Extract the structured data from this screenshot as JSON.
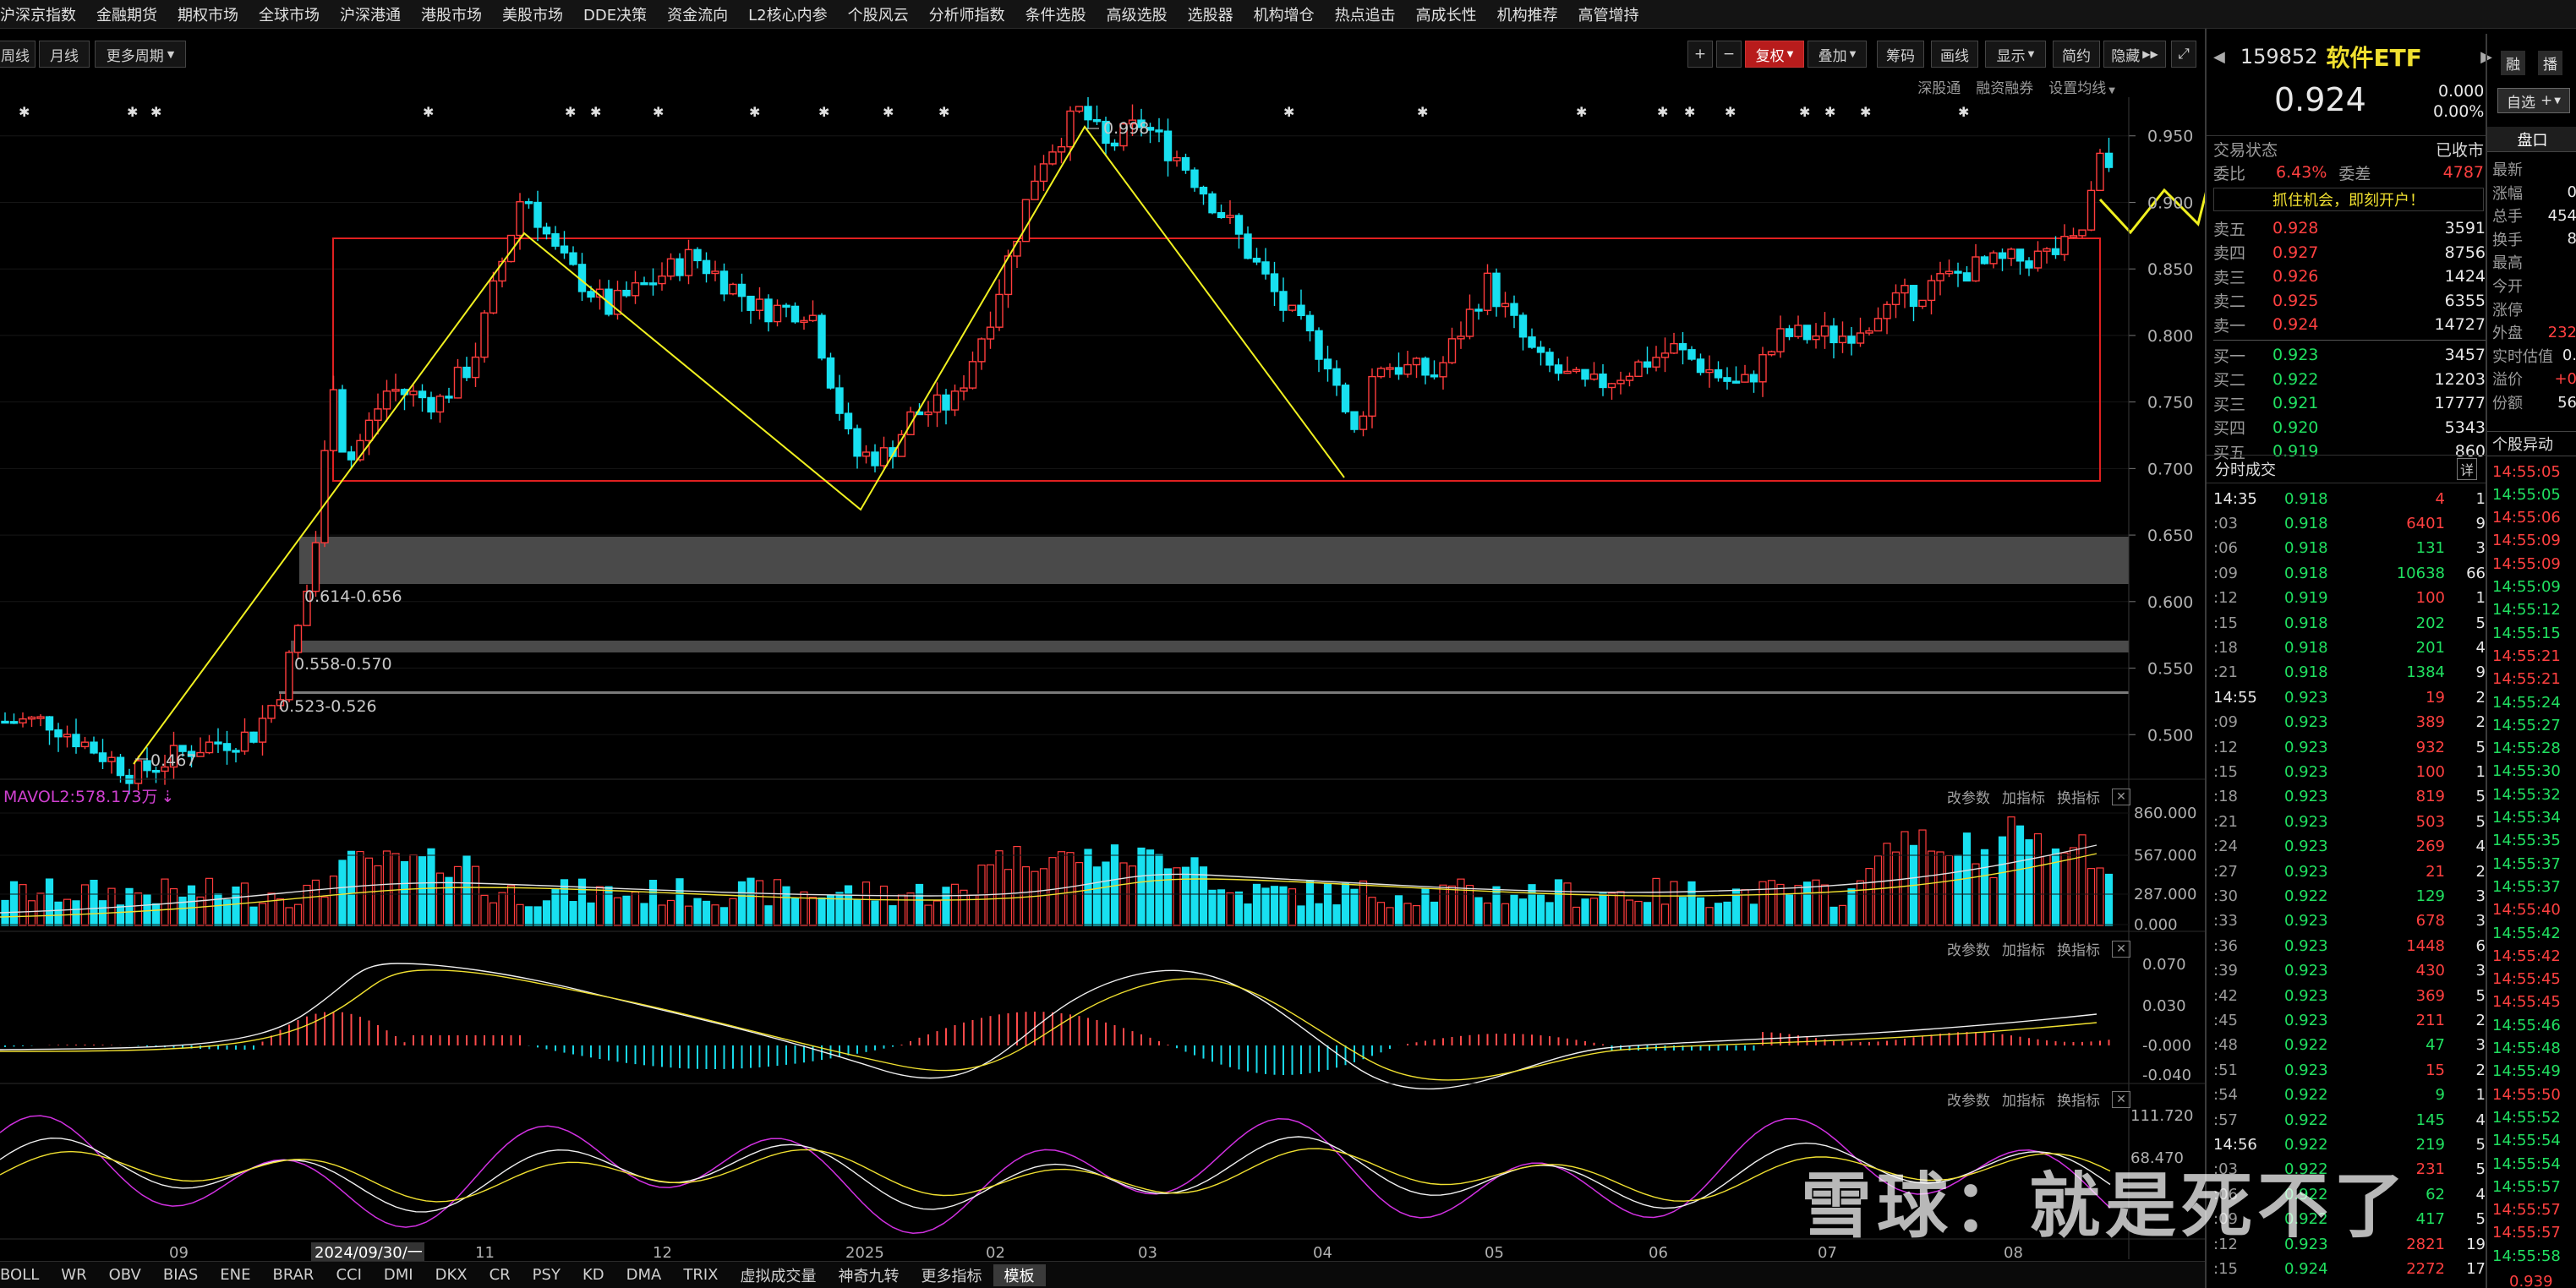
{
  "menu": [
    "沪深京指数",
    "金融期货",
    "期权市场",
    "全球市场",
    "沪深港通",
    "港股市场",
    "美股市场",
    "DDE决策",
    "资金流向",
    "L2核心内参",
    "个股风云",
    "分析师指数",
    "条件选股",
    "高级选股",
    "选股器",
    "机构增仓",
    "热点追击",
    "高成长性",
    "机构推荐",
    "高管增持"
  ],
  "period_tabs": [
    "周线",
    "月线",
    "更多周期"
  ],
  "toolbar": {
    "plus": "+",
    "minus": "−",
    "fuquan": "复权",
    "overlay": "叠加",
    "chips": "筹码",
    "draw": "画线",
    "display": "显示",
    "brief": "简约",
    "hide": "隐藏"
  },
  "sublinks": [
    "深股通",
    "融资融券",
    "设置均线"
  ],
  "price_axis": [
    "0.950",
    "0.900",
    "0.850",
    "0.800",
    "0.750",
    "0.700",
    "0.650",
    "0.600",
    "0.550",
    "0.500"
  ],
  "annotations": {
    "high": "0.998",
    "low": "0.467",
    "zone1": "0.614-0.656",
    "zone2": "0.558-0.570",
    "zone3": "0.523-0.526"
  },
  "mavol_label": "MAVOL2:578.173万",
  "vol_axis": [
    "860.000",
    "567.000",
    "287.000",
    "0.000"
  ],
  "macd_axis": [
    "0.070",
    "0.030",
    "-0.000",
    "-0.040"
  ],
  "kdj_axis": [
    "111.720",
    "68.470"
  ],
  "panel_tools": [
    "改参数",
    "加指标",
    "换指标"
  ],
  "x_axis": [
    "09",
    "2024/09/30/一",
    "11",
    "12",
    "2025",
    "02",
    "03",
    "04",
    "05",
    "06",
    "07",
    "08"
  ],
  "bottom_tabs": [
    "BOLL",
    "WR",
    "OBV",
    "BIAS",
    "ENE",
    "BRAR",
    "CCI",
    "DMI",
    "DKX",
    "CR",
    "PSY",
    "KD",
    "DMA",
    "TRIX",
    "虚拟成交量",
    "神奇九转",
    "更多指标",
    "模板"
  ],
  "watermark": "雪球：就是死不了",
  "quote": {
    "code": "159852",
    "name": "软件ETF",
    "price": "0.924",
    "change": "0.000",
    "change_pct": "0.00%",
    "buttons": [
      "融",
      "播"
    ],
    "status_label": "交易状态",
    "status_value": "已收市",
    "weibi_label": "委比",
    "weibi_value": "6.43%",
    "weicha_label": "委差",
    "weicha_value": "4787",
    "promo": "抓住机会，即刻开户！"
  },
  "order_book": {
    "asks": [
      {
        "label": "卖五",
        "price": "0.928",
        "vol": "3591"
      },
      {
        "label": "卖四",
        "price": "0.927",
        "vol": "8756"
      },
      {
        "label": "卖三",
        "price": "0.926",
        "vol": "1424"
      },
      {
        "label": "卖二",
        "price": "0.925",
        "vol": "6355"
      },
      {
        "label": "卖一",
        "price": "0.924",
        "vol": "14727"
      }
    ],
    "bids": [
      {
        "label": "买一",
        "price": "0.923",
        "vol": "3457"
      },
      {
        "label": "买二",
        "price": "0.922",
        "vol": "12203"
      },
      {
        "label": "买三",
        "price": "0.921",
        "vol": "17777"
      },
      {
        "label": "买四",
        "price": "0.920",
        "vol": "5343"
      },
      {
        "label": "买五",
        "price": "0.919",
        "vol": "860"
      }
    ]
  },
  "ticks_header": {
    "title": "分时成交",
    "detail": "详"
  },
  "ticks": [
    {
      "t": "14:35",
      "p": "0.918",
      "v": "4",
      "n": "1",
      "c": "g",
      "vc": "r"
    },
    {
      "t": ":03",
      "p": "0.918",
      "v": "6401",
      "n": "9",
      "c": "g",
      "vc": "r"
    },
    {
      "t": ":06",
      "p": "0.918",
      "v": "131",
      "n": "3",
      "c": "g",
      "vc": "g"
    },
    {
      "t": ":09",
      "p": "0.918",
      "v": "10638",
      "n": "66",
      "c": "g",
      "vc": "g"
    },
    {
      "t": ":12",
      "p": "0.919",
      "v": "100",
      "n": "1",
      "c": "g",
      "vc": "r"
    },
    {
      "t": ":15",
      "p": "0.918",
      "v": "202",
      "n": "5",
      "c": "g",
      "vc": "g"
    },
    {
      "t": ":18",
      "p": "0.918",
      "v": "201",
      "n": "4",
      "c": "g",
      "vc": "g"
    },
    {
      "t": ":21",
      "p": "0.918",
      "v": "1384",
      "n": "9",
      "c": "g",
      "vc": "g"
    },
    {
      "t": "14:55",
      "p": "0.923",
      "v": "19",
      "n": "2",
      "c": "g",
      "vc": "r"
    },
    {
      "t": ":09",
      "p": "0.923",
      "v": "389",
      "n": "2",
      "c": "g",
      "vc": "r"
    },
    {
      "t": ":12",
      "p": "0.923",
      "v": "932",
      "n": "5",
      "c": "g",
      "vc": "r"
    },
    {
      "t": ":15",
      "p": "0.923",
      "v": "100",
      "n": "1",
      "c": "g",
      "vc": "r"
    },
    {
      "t": ":18",
      "p": "0.923",
      "v": "819",
      "n": "5",
      "c": "g",
      "vc": "r"
    },
    {
      "t": ":21",
      "p": "0.923",
      "v": "503",
      "n": "5",
      "c": "g",
      "vc": "r"
    },
    {
      "t": ":24",
      "p": "0.923",
      "v": "269",
      "n": "4",
      "c": "g",
      "vc": "r"
    },
    {
      "t": ":27",
      "p": "0.923",
      "v": "21",
      "n": "2",
      "c": "g",
      "vc": "r"
    },
    {
      "t": ":30",
      "p": "0.922",
      "v": "129",
      "n": "3",
      "c": "g",
      "vc": "g"
    },
    {
      "t": ":33",
      "p": "0.923",
      "v": "678",
      "n": "3",
      "c": "g",
      "vc": "r"
    },
    {
      "t": ":36",
      "p": "0.923",
      "v": "1448",
      "n": "6",
      "c": "g",
      "vc": "r"
    },
    {
      "t": ":39",
      "p": "0.923",
      "v": "430",
      "n": "3",
      "c": "g",
      "vc": "r"
    },
    {
      "t": ":42",
      "p": "0.923",
      "v": "369",
      "n": "5",
      "c": "g",
      "vc": "r"
    },
    {
      "t": ":45",
      "p": "0.923",
      "v": "211",
      "n": "2",
      "c": "g",
      "vc": "r"
    },
    {
      "t": ":48",
      "p": "0.922",
      "v": "47",
      "n": "3",
      "c": "g",
      "vc": "g"
    },
    {
      "t": ":51",
      "p": "0.923",
      "v": "15",
      "n": "2",
      "c": "g",
      "vc": "r"
    },
    {
      "t": ":54",
      "p": "0.922",
      "v": "9",
      "n": "1",
      "c": "g",
      "vc": "g"
    },
    {
      "t": ":57",
      "p": "0.922",
      "v": "145",
      "n": "4",
      "c": "g",
      "vc": "g"
    },
    {
      "t": "14:56",
      "p": "0.922",
      "v": "219",
      "n": "5",
      "c": "g",
      "vc": "g"
    },
    {
      "t": ":03",
      "p": "0.922",
      "v": "231",
      "n": "5",
      "c": "g",
      "vc": "r"
    },
    {
      "t": ":06",
      "p": "0.922",
      "v": "62",
      "n": "4",
      "c": "g",
      "vc": "g"
    },
    {
      "t": ":09",
      "p": "0.922",
      "v": "417",
      "n": "5",
      "c": "g",
      "vc": "g"
    },
    {
      "t": ":12",
      "p": "0.923",
      "v": "2821",
      "n": "19",
      "c": "g",
      "vc": "r"
    },
    {
      "t": ":15",
      "p": "0.924",
      "v": "2272",
      "n": "17",
      "c": "g",
      "vc": "r"
    }
  ],
  "far_right": {
    "buttons": [
      "自选"
    ],
    "tab": "盘口",
    "labels": [
      "最新",
      "涨幅",
      "总手",
      "换手",
      "最高",
      "今开",
      "涨停",
      "外盘",
      "实时估值",
      "溢价",
      "份额"
    ],
    "values": [
      "",
      "0",
      "454",
      "8",
      "",
      "",
      "",
      "232",
      "0.",
      "+0",
      "56"
    ],
    "section": "个股异动",
    "times": [
      "14:55:05",
      "14:55:05",
      "14:55:06",
      "14:55:09",
      "14:55:09",
      "14:55:09",
      "14:55:12",
      "14:55:15",
      "14:55:21",
      "14:55:21",
      "14:55:24",
      "14:55:27",
      "14:55:28",
      "14:55:30",
      "14:55:32",
      "14:55:34",
      "14:55:35",
      "14:55:37",
      "14:55:37",
      "14:55:40",
      "14:55:42",
      "14:55:42",
      "14:55:45",
      "14:55:45",
      "14:55:46",
      "14:55:48",
      "14:55:49",
      "14:55:50",
      "14:55:52",
      "14:55:54",
      "14:55:54",
      "14:55:57",
      "14:55:57",
      "14:55:57",
      "14:55:58"
    ],
    "time_colors": [
      "r",
      "g",
      "r",
      "r",
      "r",
      "g",
      "g",
      "g",
      "r",
      "r",
      "g",
      "g",
      "g",
      "g",
      "g",
      "g",
      "g",
      "g",
      "g",
      "r",
      "g",
      "r",
      "r",
      "r",
      "g",
      "g",
      "g",
      "r",
      "g",
      "g",
      "g",
      "g",
      "r",
      "r",
      "g"
    ],
    "bottom": "0.939"
  },
  "colors": {
    "up": "#ff3c3c",
    "down": "#18e0f0",
    "accent_yellow": "#f0f020",
    "box": "#e02020"
  }
}
